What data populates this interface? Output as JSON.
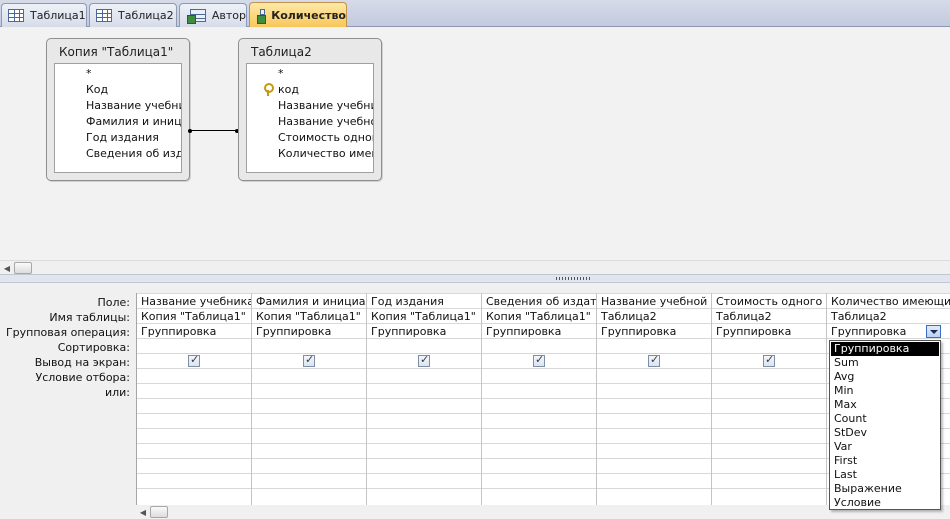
{
  "tabs": [
    {
      "label": "Таблица1",
      "icon": "table-icon"
    },
    {
      "label": "Таблица2",
      "icon": "table-icon"
    },
    {
      "label": "Автор",
      "icon": "query-icon"
    },
    {
      "label": "Количество",
      "icon": "query-icon",
      "active": true
    }
  ],
  "tables": [
    {
      "title": "Копия \"Таблица1\"",
      "fields": [
        "*",
        "Код",
        "Название учебник",
        "Фамилия и инициа",
        "Год издания",
        "Сведения об издат"
      ]
    },
    {
      "title": "Таблица2",
      "fields": [
        "*",
        "код",
        "Название учебник",
        "Название учебной",
        "Стоимость одного",
        "Количество имею"
      ]
    }
  ],
  "row_labels": {
    "field": "Поле:",
    "table": "Имя таблицы:",
    "group": "Групповая операция:",
    "sort": "Сортировка:",
    "show": "Вывод на экран:",
    "criteria": "Условие отбора:",
    "or": "или:"
  },
  "columns": [
    {
      "field": "Название учебника",
      "table": "Копия \"Таблица1\"",
      "group": "Группировка",
      "show": true
    },
    {
      "field": "Фамилия и инициалы",
      "table": "Копия \"Таблица1\"",
      "group": "Группировка",
      "show": true
    },
    {
      "field": "Год издания",
      "table": "Копия \"Таблица1\"",
      "group": "Группировка",
      "show": true
    },
    {
      "field": "Сведения об издател",
      "table": "Копия \"Таблица1\"",
      "group": "Группировка",
      "show": true
    },
    {
      "field": "Название учебной д",
      "table": "Таблица2",
      "group": "Группировка",
      "show": true
    },
    {
      "field": "Стоимость одного эк",
      "table": "Таблица2",
      "group": "Группировка",
      "show": true
    },
    {
      "field": "Количество имеющи",
      "table": "Таблица2",
      "group": "Группировка",
      "show": false
    }
  ],
  "dropdown": {
    "selected": "Группировка",
    "options": [
      "Группировка",
      "Sum",
      "Avg",
      "Min",
      "Max",
      "Count",
      "StDev",
      "Var",
      "First",
      "Last",
      "Выражение",
      "Условие"
    ]
  },
  "colors": {
    "active_tab": "#f8c75a",
    "selection": "#000000"
  }
}
